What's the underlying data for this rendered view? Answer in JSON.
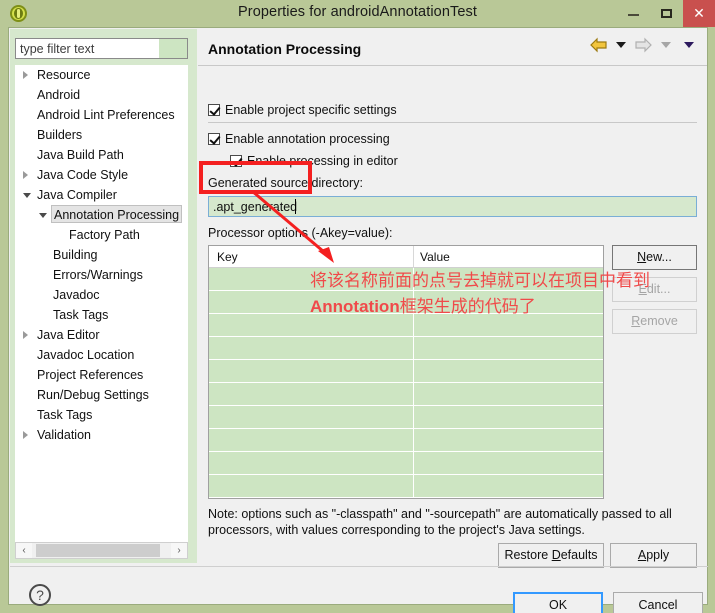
{
  "window": {
    "title": "Properties for androidAnnotationTest",
    "icon": "eclipse-icon",
    "minimize_label": "–",
    "maximize_label": "□",
    "close_label": "✕"
  },
  "sidebar": {
    "filter": {
      "value": "type filter text",
      "placeholder": "type filter text"
    },
    "items": [
      {
        "label": "Resource",
        "indent": 0,
        "twisty": "closed",
        "selected": false
      },
      {
        "label": "Android",
        "indent": 0,
        "twisty": "none",
        "selected": false
      },
      {
        "label": "Android Lint Preferences",
        "indent": 0,
        "twisty": "none",
        "selected": false
      },
      {
        "label": "Builders",
        "indent": 0,
        "twisty": "none",
        "selected": false
      },
      {
        "label": "Java Build Path",
        "indent": 0,
        "twisty": "none",
        "selected": false
      },
      {
        "label": "Java Code Style",
        "indent": 0,
        "twisty": "closed",
        "selected": false
      },
      {
        "label": "Java Compiler",
        "indent": 0,
        "twisty": "open",
        "selected": false
      },
      {
        "label": "Annotation Processing",
        "indent": 1,
        "twisty": "open",
        "selected": true
      },
      {
        "label": "Factory Path",
        "indent": 2,
        "twisty": "none",
        "selected": false
      },
      {
        "label": "Building",
        "indent": 1,
        "twisty": "none",
        "selected": false
      },
      {
        "label": "Errors/Warnings",
        "indent": 1,
        "twisty": "none",
        "selected": false
      },
      {
        "label": "Javadoc",
        "indent": 1,
        "twisty": "none",
        "selected": false
      },
      {
        "label": "Task Tags",
        "indent": 1,
        "twisty": "none",
        "selected": false
      },
      {
        "label": "Java Editor",
        "indent": 0,
        "twisty": "closed",
        "selected": false
      },
      {
        "label": "Javadoc Location",
        "indent": 0,
        "twisty": "none",
        "selected": false
      },
      {
        "label": "Project References",
        "indent": 0,
        "twisty": "none",
        "selected": false
      },
      {
        "label": "Run/Debug Settings",
        "indent": 0,
        "twisty": "none",
        "selected": false
      },
      {
        "label": "Task Tags",
        "indent": 0,
        "twisty": "none",
        "selected": false
      },
      {
        "label": "Validation",
        "indent": 0,
        "twisty": "closed",
        "selected": false
      }
    ],
    "scrollbar": {
      "left_arrow": "‹",
      "right_arrow": "›"
    }
  },
  "content": {
    "title": "Annotation Processing",
    "nav": {
      "back_icon": "back-arrow-icon",
      "back_menu_icon": "chevron-down-icon",
      "forward_icon": "forward-arrow-icon",
      "forward_menu_icon": "chevron-down-icon",
      "view_menu_icon": "chevron-down-icon"
    },
    "checkboxes": [
      {
        "label": "Enable project specific settings",
        "checked": true
      },
      {
        "label": "Enable annotation processing",
        "checked": true
      },
      {
        "label": "Enable processing in editor",
        "checked": true
      }
    ],
    "generated_source": {
      "label": "Generated source directory:",
      "value": ".apt_generated"
    },
    "processor_options": {
      "label": "Processor options (-Akey=value):",
      "columns": [
        "Key",
        "Value"
      ],
      "rows": [
        {
          "key": "",
          "value": ""
        },
        {
          "key": "",
          "value": ""
        },
        {
          "key": "",
          "value": ""
        },
        {
          "key": "",
          "value": ""
        },
        {
          "key": "",
          "value": ""
        },
        {
          "key": "",
          "value": ""
        },
        {
          "key": "",
          "value": ""
        },
        {
          "key": "",
          "value": ""
        },
        {
          "key": "",
          "value": ""
        },
        {
          "key": "",
          "value": ""
        }
      ],
      "buttons": [
        {
          "label": "New...",
          "enabled": true
        },
        {
          "label": "Edit...",
          "enabled": false
        },
        {
          "label": "Remove",
          "enabled": false
        }
      ]
    },
    "note": "Note: options such as \"-classpath\" and \"-sourcepath\" are automatically passed to all processors, with values corresponding to the project's Java settings.",
    "restore_defaults_label": "Restore Defaults",
    "apply_label": "Apply"
  },
  "footer": {
    "help_label": "?",
    "ok_label": "OK",
    "cancel_label": "Cancel"
  },
  "annotation": {
    "line1_cn": "将该名称前面的点号去掉就可以在项目中看到",
    "line2_en": "Annotation",
    "line2_cn": "框架生成的代码了",
    "color": "#f04a4a",
    "box_color": "#f42020"
  },
  "colors": {
    "window_frame": "#b9c897",
    "panel_bg": "#f0f0f0",
    "table_row": "#cde5c2",
    "close_button": "#c9504e",
    "focus_border": "#3399ff"
  }
}
